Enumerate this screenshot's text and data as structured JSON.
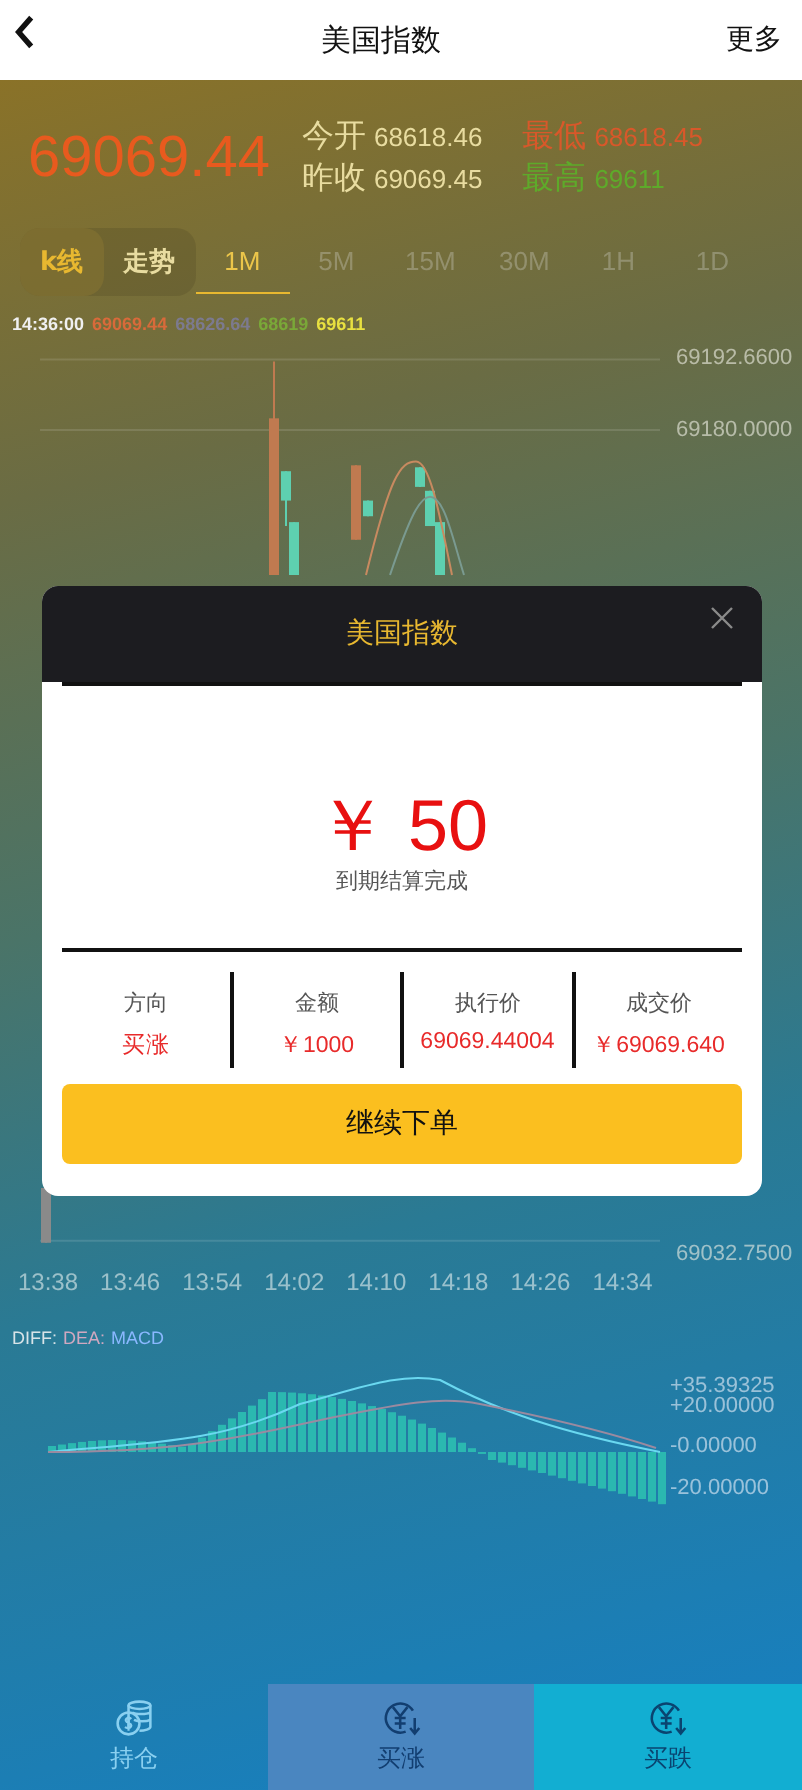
{
  "header": {
    "title": "美国指数",
    "more": "更多"
  },
  "quote": {
    "price": "69069.44",
    "stats": [
      {
        "label": "今开",
        "value": "68618.46",
        "kind": "neutral"
      },
      {
        "label": "最低",
        "value": "68618.45",
        "kind": "down"
      },
      {
        "label": "昨收",
        "value": "69069.45",
        "kind": "neutral"
      },
      {
        "label": "最高",
        "value": "69611",
        "kind": "up"
      }
    ]
  },
  "chart_modes": [
    {
      "label": "k线",
      "selected": true
    },
    {
      "label": "走势",
      "selected": false
    }
  ],
  "periods": [
    {
      "label": "1M",
      "selected": true
    },
    {
      "label": "5M",
      "selected": false
    },
    {
      "label": "15M",
      "selected": false
    },
    {
      "label": "30M",
      "selected": false
    },
    {
      "label": "1H",
      "selected": false
    },
    {
      "label": "1D",
      "selected": false
    }
  ],
  "kline": {
    "info": [
      {
        "text": "14:36:00",
        "color": "#f0f0f0"
      },
      {
        "text": "69069.44",
        "color": "#d86a3a"
      },
      {
        "text": "68626.64",
        "color": "#7c7a8e"
      },
      {
        "text": "68619",
        "color": "#7aa838"
      },
      {
        "text": "69611",
        "color": "#e8e040"
      }
    ],
    "price_axis": [
      "69192.6600",
      "69180.0000",
      "69032.7500"
    ],
    "time_axis": [
      "13:38",
      "13:46",
      "13:54",
      "14:02",
      "14:10",
      "14:18",
      "14:26",
      "14:34"
    ]
  },
  "macd": {
    "legend": [
      {
        "text": "DIFF:",
        "color": "#d8e4e8"
      },
      {
        "text": "DEA:",
        "color": "#d0a8c0"
      },
      {
        "text": "MACD",
        "color": "#8ab8ff"
      }
    ],
    "axis": [
      "+35.39325",
      "+20.00000",
      "-0.00000",
      "-20.00000"
    ]
  },
  "dialog": {
    "title": "美国指数",
    "amount": "￥ 50",
    "status": "到期结算完成",
    "columns": [
      {
        "label": "方向",
        "value": "买涨"
      },
      {
        "label": "金额",
        "value": "￥1000"
      },
      {
        "label": "执行价",
        "value": "69069.44004"
      },
      {
        "label": "成交价",
        "value": "￥69069.640"
      }
    ],
    "button": "继续下单"
  },
  "bottom_nav": [
    {
      "label": "持仓",
      "kind": "position"
    },
    {
      "label": "买涨",
      "kind": "buy_up"
    },
    {
      "label": "买跌",
      "kind": "buy_down"
    }
  ]
}
